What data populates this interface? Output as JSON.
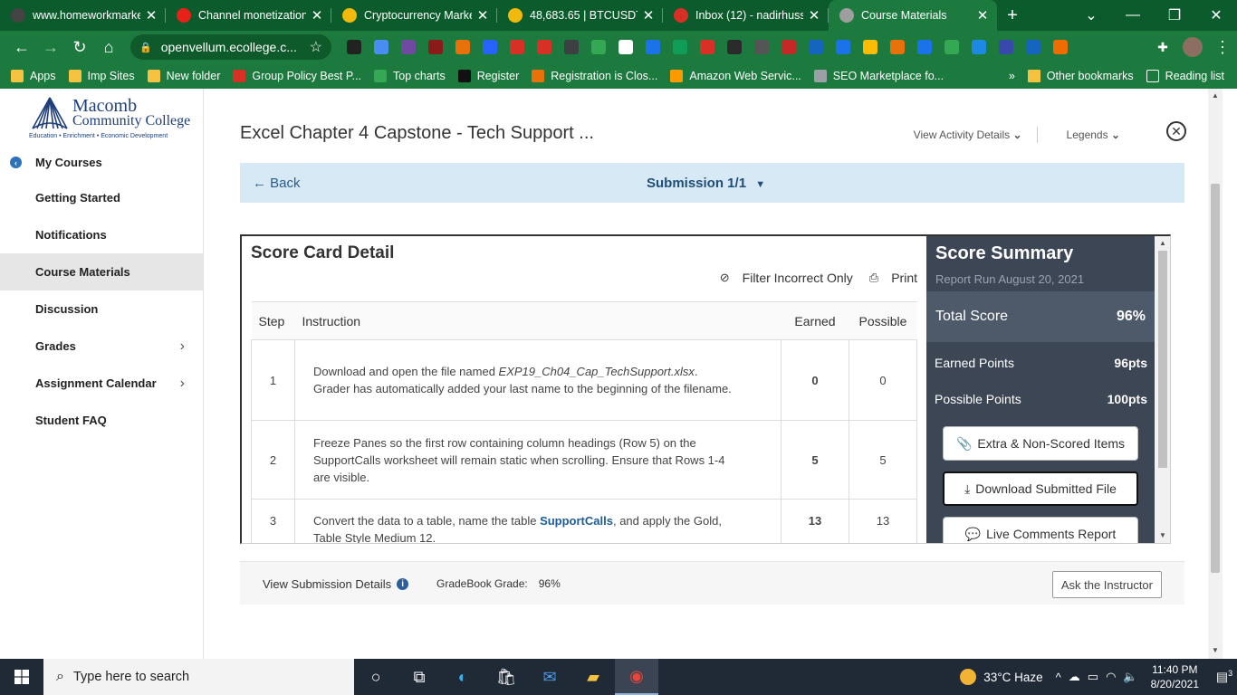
{
  "browser": {
    "tabs": [
      {
        "title": "www.homeworkmarke",
        "fav_color": "#444444",
        "active": false
      },
      {
        "title": "Channel monetization",
        "fav_color": "#e62117",
        "active": false
      },
      {
        "title": "Cryptocurrency Marke",
        "fav_color": "#f0b90b",
        "active": false
      },
      {
        "title": "48,683.65 | BTCUSDT",
        "fav_color": "#f0b90b",
        "active": false
      },
      {
        "title": "Inbox (12) - nadirhuss",
        "fav_color": "#d93025",
        "active": false
      },
      {
        "title": "Course Materials",
        "fav_color": "#9e9e9e",
        "active": true
      }
    ],
    "url": "openvellum.ecollege.c...",
    "bookmarks": [
      {
        "label": "Apps",
        "color": "#f6c341"
      },
      {
        "label": "Imp Sites",
        "color": "#f6c341"
      },
      {
        "label": "New folder",
        "color": "#f6c341"
      },
      {
        "label": "Group Policy Best P...",
        "color": "#d93025"
      },
      {
        "label": "Top charts",
        "color": "#34a853"
      },
      {
        "label": "Register",
        "color": "#111111"
      },
      {
        "label": "Registration is Clos...",
        "color": "#e8710a"
      },
      {
        "label": "Amazon Web Servic...",
        "color": "#ff9900"
      },
      {
        "label": "SEO Marketplace fo...",
        "color": "#9aa0a6"
      }
    ],
    "bookmarks_more": "»",
    "other_bookmarks": "Other bookmarks",
    "reading_list": "Reading list",
    "extension_colors": [
      "#222222",
      "#4a8df0",
      "#6f4aa0",
      "#8b1a1a",
      "#e8710a",
      "#2962ff",
      "#d93025",
      "#d93025",
      "#3c4043",
      "#34a853",
      "#ffffff",
      "#1a73e8",
      "#0f9d58",
      "#d93025",
      "#2b2b2b",
      "#555555",
      "#c62828",
      "#1565c0",
      "#1a73e8",
      "#fbbc04",
      "#e8710a",
      "#1a73e8",
      "#34a853",
      "#1e88e5",
      "#3949ab",
      "#1565c0",
      "#ef6c00"
    ]
  },
  "sidebar": {
    "college_line1": "Macomb",
    "college_line2": "Community College",
    "tagline": "Education • Enrichment • Economic Development",
    "my_courses": "My Courses",
    "items": [
      {
        "label": "Getting Started",
        "has_arrow": false,
        "active": false
      },
      {
        "label": "Notifications",
        "has_arrow": false,
        "active": false
      },
      {
        "label": "Course Materials",
        "has_arrow": false,
        "active": true
      },
      {
        "label": "Discussion",
        "has_arrow": false,
        "active": false
      },
      {
        "label": "Grades",
        "has_arrow": true,
        "active": false
      },
      {
        "label": "Assignment Calendar",
        "has_arrow": true,
        "active": false
      },
      {
        "label": "Student FAQ",
        "has_arrow": false,
        "active": false
      }
    ]
  },
  "activity": {
    "title": "Excel Chapter 4 Capstone - Tech Support ...",
    "view_details": "View Activity Details",
    "legends": "Legends",
    "back": "Back",
    "submission": "Submission 1/1"
  },
  "scorecard": {
    "heading": "Score Card Detail",
    "filter": "Filter Incorrect Only",
    "print": "Print",
    "columns": {
      "step": "Step",
      "instruction": "Instruction",
      "earned": "Earned",
      "possible": "Possible"
    },
    "rows": [
      {
        "step": "1",
        "pre": "Download and open the file named ",
        "emph": "EXP19_Ch04_Cap_TechSupport.xlsx",
        "post": ". Grader has automatically added your last name to the beginning of the filename.",
        "earned": "0",
        "possible": "0"
      },
      {
        "step": "2",
        "pre": "Freeze Panes so the first row containing column headings (Row 5) on the SupportCalls worksheet will remain static when scrolling. Ensure that Rows 1-4 are visible.",
        "emph": "",
        "post": "",
        "earned": "5",
        "possible": "5"
      },
      {
        "step": "3",
        "pre": "Convert the data to a table, name the table ",
        "emph": "SupportCalls",
        "post": ", and apply the Gold, Table Style Medium 12.",
        "earned": "13",
        "possible": "13"
      }
    ]
  },
  "summary": {
    "heading": "Score Summary",
    "report_run": "Report Run August 20, 2021",
    "total_label": "Total Score",
    "total_value": "96%",
    "earned_label": "Earned Points",
    "earned_value": "96pts",
    "possible_label": "Possible Points",
    "possible_value": "100pts",
    "btn_extra": "Extra & Non-Scored Items",
    "btn_download": "Download Submitted File",
    "btn_comments": "Live Comments Report"
  },
  "footer": {
    "view_submission": "View Submission Details",
    "gradebook_label": "GradeBook Grade:",
    "gradebook_value": "96%",
    "ask": "Ask the Instructor"
  },
  "taskbar": {
    "search_placeholder": "Type here to search",
    "weather": "33°C  Haze",
    "time": "11:40 PM",
    "date": "8/20/2021",
    "notif_count": "3"
  }
}
